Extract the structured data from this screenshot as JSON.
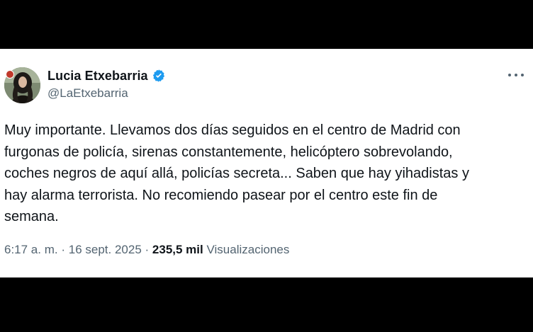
{
  "tweet": {
    "author": {
      "display_name": "Lucia Etxebarria",
      "handle": "@LaEtxebarria",
      "verified": true,
      "verified_color": "#1d9bf0"
    },
    "body_lines": [
      "Muy importante. Llevamos dos días seguidos en el centro de Madrid con",
      "furgonas de policía, sirenas constantemente, helicóptero sobrevolando,",
      "coches negros de aquí allá, policías secreta... Saben que hay yihadistas y",
      "hay alarma terrorista. No recomiendo pasear por el centro este fin de",
      "semana."
    ],
    "meta": {
      "time": "6:17 a. m.",
      "separator": "·",
      "date": "16 sept. 2025",
      "views_count": "235,5 mil",
      "views_label": "Visualizaciones"
    },
    "icons": {
      "verified": "verified-badge-icon",
      "more": "more-options-icon"
    }
  }
}
